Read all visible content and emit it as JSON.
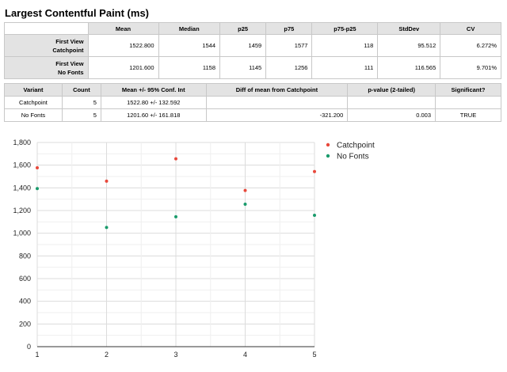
{
  "title": "Largest Contentful Paint (ms)",
  "stats_table": {
    "headers": [
      "Mean",
      "Median",
      "p25",
      "p75",
      "p75-p25",
      "StdDev",
      "CV"
    ],
    "rows": [
      {
        "label_line1": "First View",
        "label_line2": "Catchpoint",
        "values": [
          "1522.800",
          "1544",
          "1459",
          "1577",
          "118",
          "95.512",
          "6.272%"
        ]
      },
      {
        "label_line1": "First View",
        "label_line2": "No Fonts",
        "values": [
          "1201.600",
          "1158",
          "1145",
          "1256",
          "111",
          "116.565",
          "9.701%"
        ]
      }
    ]
  },
  "sig_table": {
    "headers": [
      "Variant",
      "Count",
      "Mean +/- 95% Conf. Int",
      "Diff of mean from Catchpoint",
      "p-value (2-tailed)",
      "Significant?"
    ],
    "rows": [
      [
        "Catchpoint",
        "5",
        "1522.80 +/- 132.592",
        "",
        "",
        ""
      ],
      [
        "No Fonts",
        "5",
        "1201.60 +/- 161.818",
        "-321.200",
        "0.003",
        "TRUE"
      ]
    ]
  },
  "chart_data": {
    "type": "scatter",
    "x": [
      1,
      2,
      3,
      4,
      5
    ],
    "xlim": [
      1,
      5
    ],
    "ylim": [
      0,
      1800
    ],
    "xticks": [
      "1",
      "2",
      "3",
      "4",
      "5"
    ],
    "yticks": [
      "0",
      "200",
      "400",
      "600",
      "800",
      "1,000",
      "1,200",
      "1,400",
      "1,600",
      "1,800"
    ],
    "grid": true,
    "legend_position": "right",
    "series": [
      {
        "name": "Catchpoint",
        "color": "#e8483b",
        "values": [
          1577,
          1459,
          1656,
          1377,
          1544
        ]
      },
      {
        "name": "No Fonts",
        "color": "#1a9b6c",
        "values": [
          1394,
          1051,
          1145,
          1256,
          1158
        ]
      }
    ]
  }
}
